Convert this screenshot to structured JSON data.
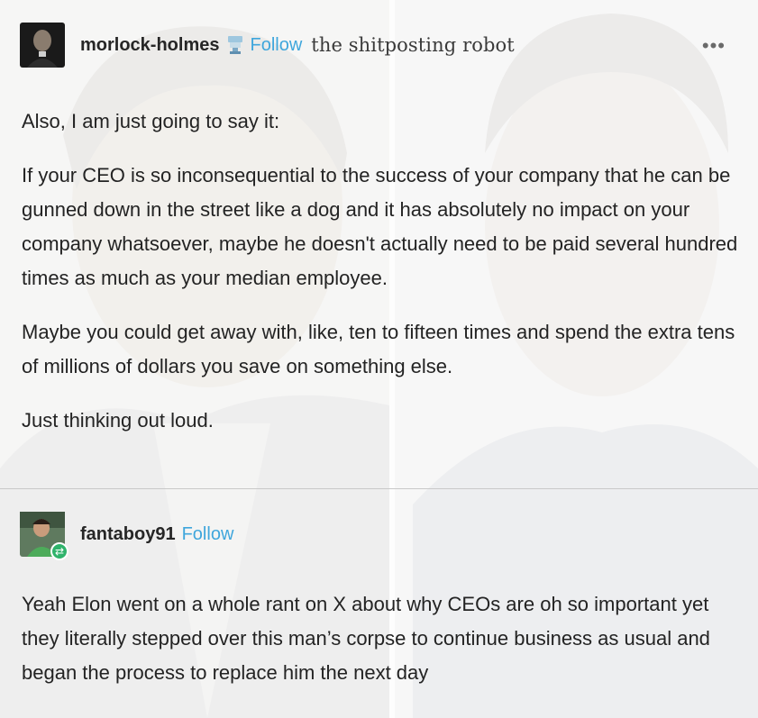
{
  "post": {
    "author": {
      "username": "morlock-holmes",
      "badge_icon": "trophy-badge-icon",
      "follow_label": "Follow",
      "blog_title": "the shitposting robot"
    },
    "more_label": "•••",
    "paragraphs": [
      "Also, I am just going to say it:",
      "If your CEO is so inconsequential to the success of your company that he can be gunned down in the street like a dog and it has absolutely no impact on your company whatsoever, maybe he doesn't actually need to be paid several hundred times as much as your median employee.",
      "Maybe you could get away with, like, ten to fifteen times and spend the extra tens of millions of dollars you save on something else.",
      "Just thinking out loud."
    ]
  },
  "reblog": {
    "author": {
      "username": "fantaboy91",
      "follow_label": "Follow",
      "status_icon": "reblog-icon"
    },
    "paragraphs": [
      "Yeah Elon went on a whole rant on X about why CEOs are oh so important yet they literally stepped over this man’s corpse to continue business as usual and began the process to replace him the next day"
    ]
  },
  "colors": {
    "follow": "#3fa6dc",
    "reblog_badge": "#2fb36b",
    "text": "#232323"
  }
}
